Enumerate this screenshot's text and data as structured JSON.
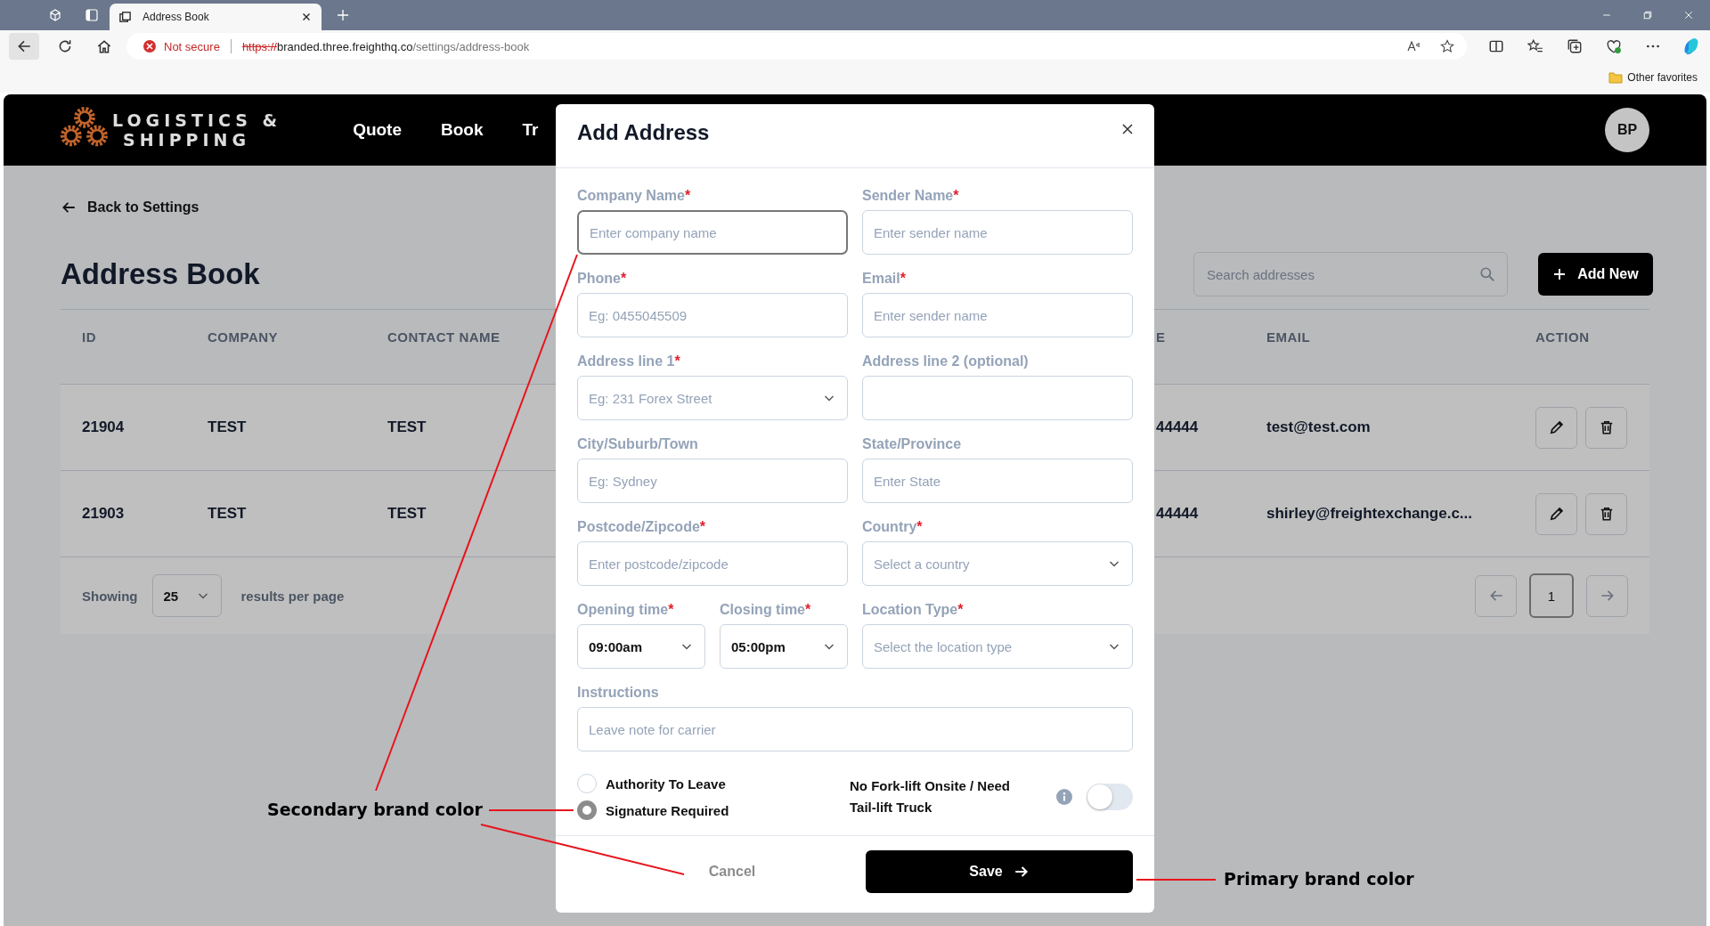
{
  "browser": {
    "tab_title": "Address Book",
    "security": "Not secure",
    "url_scheme": "https://",
    "url_host": "branded.three.freighthq.co",
    "url_path": "/settings/address-book",
    "favorites": "Other favorites"
  },
  "header": {
    "logo_line1": "LOGISTICS &",
    "logo_line2": "SHIPPING",
    "nav": [
      {
        "label": "Quote"
      },
      {
        "label": "Book"
      },
      {
        "label": "Tr"
      }
    ],
    "avatar": "BP"
  },
  "page": {
    "back_link": "Back to Settings",
    "title": "Address Book",
    "search": {
      "placeholder": "Search addresses"
    },
    "add_button": "Add New"
  },
  "table": {
    "columns": [
      "ID",
      "COMPANY",
      "CONTACT NAME",
      "E",
      "EMAIL",
      "ACTION"
    ],
    "rows": [
      {
        "id": "21904",
        "company": "TEST",
        "contact": "TEST",
        "column_4": "44444",
        "email": "test@test.com"
      },
      {
        "id": "21903",
        "company": "TEST",
        "contact": "TEST",
        "column_4": "44444",
        "email": "shirley@freightexchange.c..."
      }
    ]
  },
  "pagination": {
    "showing": "Showing",
    "per_page": "25",
    "per_page_suffix": "results per page",
    "pages": [
      {
        "label": "1",
        "selected": true
      }
    ]
  },
  "modal": {
    "title": "Add Address",
    "fields": [
      {
        "label": "Company Name",
        "required_mark": "*",
        "kind": "text",
        "placeholder": "Enter company name",
        "focused": true
      },
      {
        "label": "Sender Name",
        "required_mark": "*",
        "kind": "text",
        "placeholder": "Enter sender name",
        "focused": false
      },
      {
        "label": "Phone",
        "required_mark": "*",
        "kind": "text",
        "placeholder": "Eg: 0455045509",
        "focused": false
      },
      {
        "label": "Email",
        "required_mark": "*",
        "kind": "text",
        "placeholder": "Enter sender name",
        "focused": false
      },
      {
        "label": "Address line 1",
        "required_mark": "*",
        "kind": "select",
        "placeholder": "Eg: 231 Forex Street",
        "focused": false
      },
      {
        "label": "Address line 2 (optional)",
        "kind": "text",
        "focused": false
      },
      {
        "label": "City/Suburb/Town",
        "kind": "text",
        "placeholder": "Eg: Sydney",
        "focused": false
      },
      {
        "label": "State/Province",
        "kind": "text",
        "placeholder": "Enter State",
        "focused": false
      },
      {
        "label": "Postcode/Zipcode",
        "required_mark": "*",
        "kind": "text",
        "placeholder": "Enter postcode/zipcode",
        "focused": false
      },
      {
        "label": "Country",
        "required_mark": "*",
        "kind": "select",
        "placeholder": "Select a country",
        "focused": false
      },
      {
        "label": "Opening time",
        "required_mark": "*",
        "kind": "time",
        "value": "09:00am",
        "focused": false
      },
      {
        "label": "Closing time",
        "required_mark": "*",
        "kind": "time",
        "value": "05:00pm",
        "focused": false
      },
      {
        "label": "Location Type",
        "required_mark": "*",
        "kind": "select",
        "placeholder": "Select the location type",
        "focused": false
      },
      {
        "label": "Instructions",
        "kind": "note",
        "placeholder": "Leave note for carrier",
        "focused": false
      }
    ],
    "radios": [
      {
        "label": "Authority To Leave",
        "selected": false
      },
      {
        "label": "Signature Required",
        "selected": true
      }
    ],
    "toggle": {
      "label": "No Fork-lift Onsite / Need Tail-lift Truck",
      "on": false
    },
    "cancel": "Cancel",
    "save": "Save"
  },
  "annotations": [
    {
      "text": "Secondary brand color"
    },
    {
      "text": "Primary brand color"
    }
  ]
}
